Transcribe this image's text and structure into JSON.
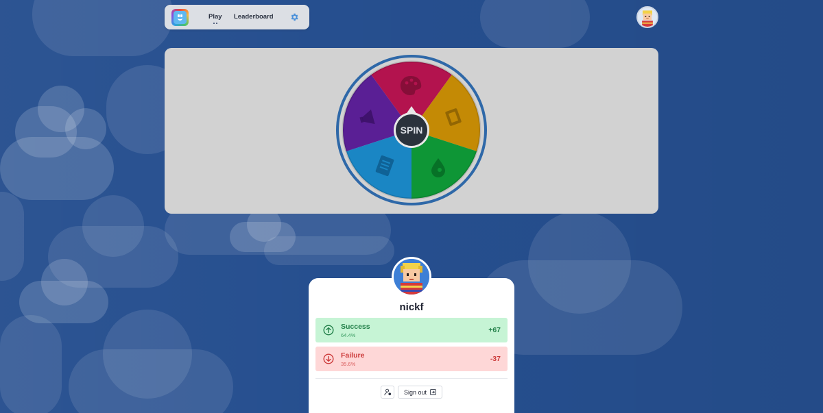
{
  "nav": {
    "play_label": "Play",
    "leaderboard_label": "Leaderboard",
    "settings_icon": "gear-icon",
    "logo_icon": "smiley-app-logo"
  },
  "wheel": {
    "center_label": "SPIN",
    "segments": [
      {
        "category": "art",
        "icon": "palette-icon",
        "color": "#b3134e"
      },
      {
        "category": "entertainment",
        "icon": "film-icon",
        "color": "#c48a05"
      },
      {
        "category": "science",
        "icon": "leaf-drop-icon",
        "color": "#0e9636"
      },
      {
        "category": "history",
        "icon": "document-icon",
        "color": "#1a86c4"
      },
      {
        "category": "sports",
        "icon": "megaphone-icon",
        "color": "#5a1f95"
      }
    ],
    "rim_color": "#2e68a8"
  },
  "profile": {
    "username": "nickf",
    "success": {
      "label": "Success",
      "percent": "64.4%",
      "value": "+67",
      "icon": "arrow-up-circle-icon"
    },
    "failure": {
      "label": "Failure",
      "percent": "35.6%",
      "value": "-37",
      "icon": "arrow-down-circle-icon"
    },
    "account_icon": "user-settings-icon",
    "signout_label": "Sign out",
    "signout_icon": "sign-out-icon"
  },
  "colors": {
    "background": "#264f8f",
    "success_bg": "#c6f4d5",
    "failure_bg": "#fed7d7"
  }
}
